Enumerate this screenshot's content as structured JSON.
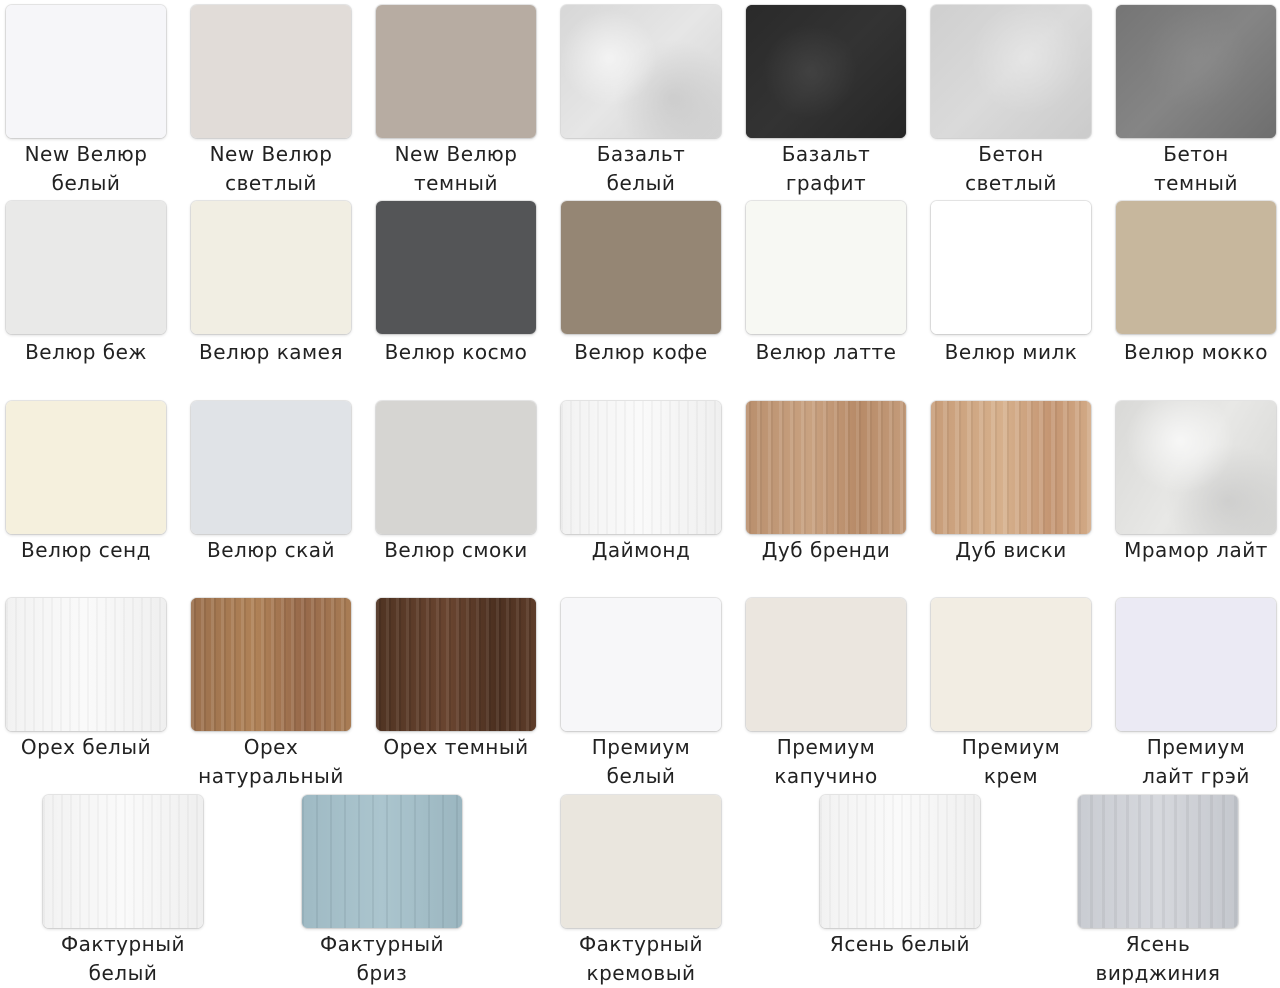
{
  "swatches": [
    {
      "name": "New Велюр\nбелый",
      "color": "#f6f6f9"
    },
    {
      "name": "New Велюр\nсветлый",
      "color": "#e1dcd8"
    },
    {
      "name": "New Велюр\nтемный",
      "color": "#b7aca2"
    },
    {
      "name": "Базальт\nбелый",
      "color": "#dcdcdc",
      "texture": "stone-light"
    },
    {
      "name": "Базальт\nграфит",
      "color": "#2e2e2e",
      "texture": "stone-graphite"
    },
    {
      "name": "Бетон\nсветлый",
      "color": "#d3d3d3",
      "texture": "concrete-light"
    },
    {
      "name": "Бетон\nтемный",
      "color": "#7a7a7a",
      "texture": "concrete-dark"
    },
    {
      "name": "Велюр беж",
      "color": "#e9e9e8"
    },
    {
      "name": "Велюр камея",
      "color": "#f1eee3"
    },
    {
      "name": "Велюр космо",
      "color": "#545557"
    },
    {
      "name": "Велюр кофе",
      "color": "#958674"
    },
    {
      "name": "Велюр латте",
      "color": "#f7f8f3"
    },
    {
      "name": "Велюр милк",
      "color": "#ffffff"
    },
    {
      "name": "Велюр мокко",
      "color": "#c7b79d"
    },
    {
      "name": "Велюр сенд",
      "color": "#f5f0dd"
    },
    {
      "name": "Велюр скай",
      "color": "#e0e3e7"
    },
    {
      "name": "Велюр смоки",
      "color": "#d6d5d2"
    },
    {
      "name": "Даймонд",
      "color": "#f8f8f8",
      "texture": "wood-white"
    },
    {
      "name": "Дуб бренди",
      "color": "#c09674",
      "texture": "wood-light"
    },
    {
      "name": "Дуб виски",
      "color": "#cda480",
      "texture": "wood-whisky"
    },
    {
      "name": "Мрамор лайт",
      "color": "#dfdfdd",
      "texture": "marble"
    },
    {
      "name": "Орех белый",
      "color": "#f0f0f0",
      "texture": "wood-white"
    },
    {
      "name": "Орех\nнатуральный",
      "color": "#a57852",
      "texture": "wood-nat"
    },
    {
      "name": "Орех темный",
      "color": "#5a3a27",
      "texture": "wood-dark"
    },
    {
      "name": "Премиум\nбелый",
      "color": "#f7f7f9"
    },
    {
      "name": "Премиум\nкапучино",
      "color": "#ebe6df"
    },
    {
      "name": "Премиум\nкрем",
      "color": "#f2ede3"
    },
    {
      "name": "Премиум\nлайт грэй",
      "color": "#ebeaf4"
    },
    {
      "name": "Фактурный\nбелый",
      "color": "#f4f4f4",
      "texture": "wood-white"
    },
    {
      "name": "Фактурный\nбриз",
      "color": "#a5c0ca",
      "texture": "breeze"
    },
    {
      "name": "Фактурный\nкремовый",
      "color": "#eae6de"
    },
    {
      "name": "Ясень белый",
      "color": "#f8f8f8",
      "texture": "wood-white"
    },
    {
      "name": "Ясень\nвирджиния",
      "color": "#cfd1d6",
      "texture": "ash-virginia"
    }
  ]
}
